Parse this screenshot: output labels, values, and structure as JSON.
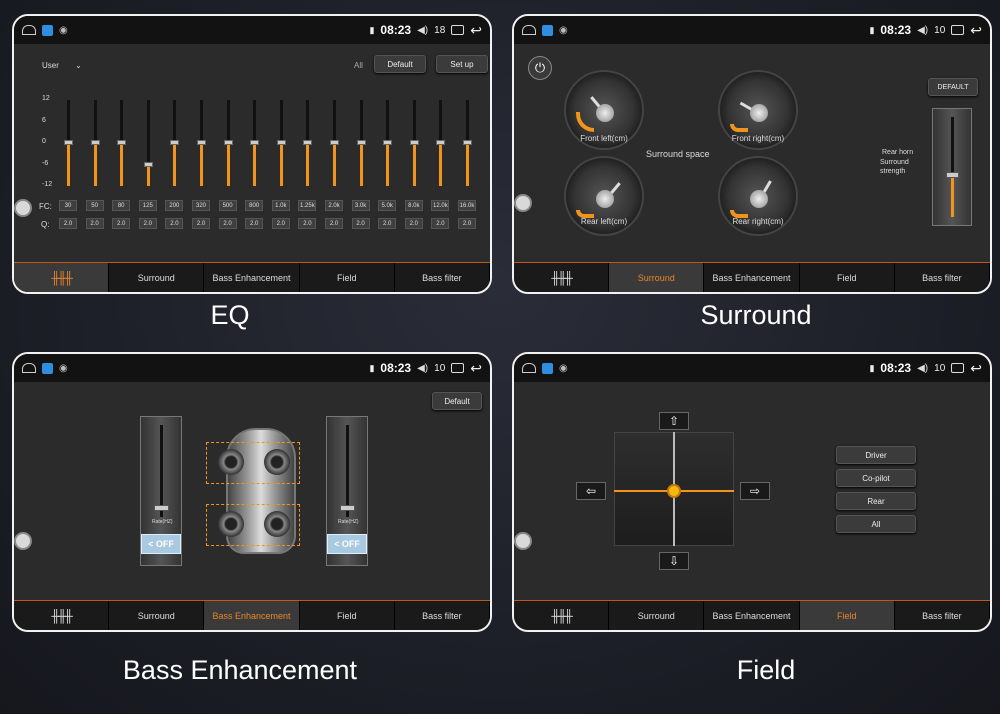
{
  "status": {
    "time": "08:23",
    "vol_eq": "18",
    "vol_other": "10"
  },
  "captions": {
    "eq": "EQ",
    "surround": "Surround",
    "bass": "Bass Enhancement",
    "field": "Field"
  },
  "tabs": {
    "surround": "Surround",
    "bass": "Bass Enhancement",
    "field": "Field",
    "bass_filter": "Bass filter"
  },
  "eq": {
    "preset": "User",
    "all": "All",
    "default": "Default",
    "setup": "Set up",
    "db_labels": [
      "12",
      "6",
      "0",
      "-6",
      "-12"
    ],
    "fc_label": "FC:",
    "q_label": "Q:",
    "fc": [
      "30",
      "50",
      "80",
      "125",
      "200",
      "320",
      "500",
      "800",
      "1.0k",
      "1.25k",
      "2.0k",
      "3.0k",
      "5.0k",
      "8.0k",
      "12.0k",
      "16.0k"
    ],
    "q": [
      "2.0",
      "2.0",
      "2.0",
      "2.0",
      "2.0",
      "2.0",
      "2.0",
      "2.0",
      "2.0",
      "2.0",
      "2.0",
      "2.0",
      "2.0",
      "2.0",
      "2.0",
      "2.0"
    ],
    "gains": [
      0,
      0,
      0,
      -6,
      0,
      0,
      0,
      0,
      0,
      0,
      0,
      0,
      0,
      0,
      0,
      0
    ]
  },
  "surround": {
    "front_left": "Front left(cm)",
    "front_right": "Front right(cm)",
    "rear_left": "Rear left(cm)",
    "rear_right": "Rear right(cm)",
    "space": "Surround space",
    "default": "DEFAULT",
    "rear_horn": "Rear horn",
    "strength": "Surround strength"
  },
  "bass": {
    "default": "Default",
    "rate": "Rate(HZ)",
    "off": "OFF"
  },
  "field": {
    "driver": "Driver",
    "copilot": "Co-pilot",
    "rear": "Rear",
    "all": "All"
  },
  "colors": {
    "accent": "#f0941c",
    "active_tab_text": "#e8862a"
  }
}
